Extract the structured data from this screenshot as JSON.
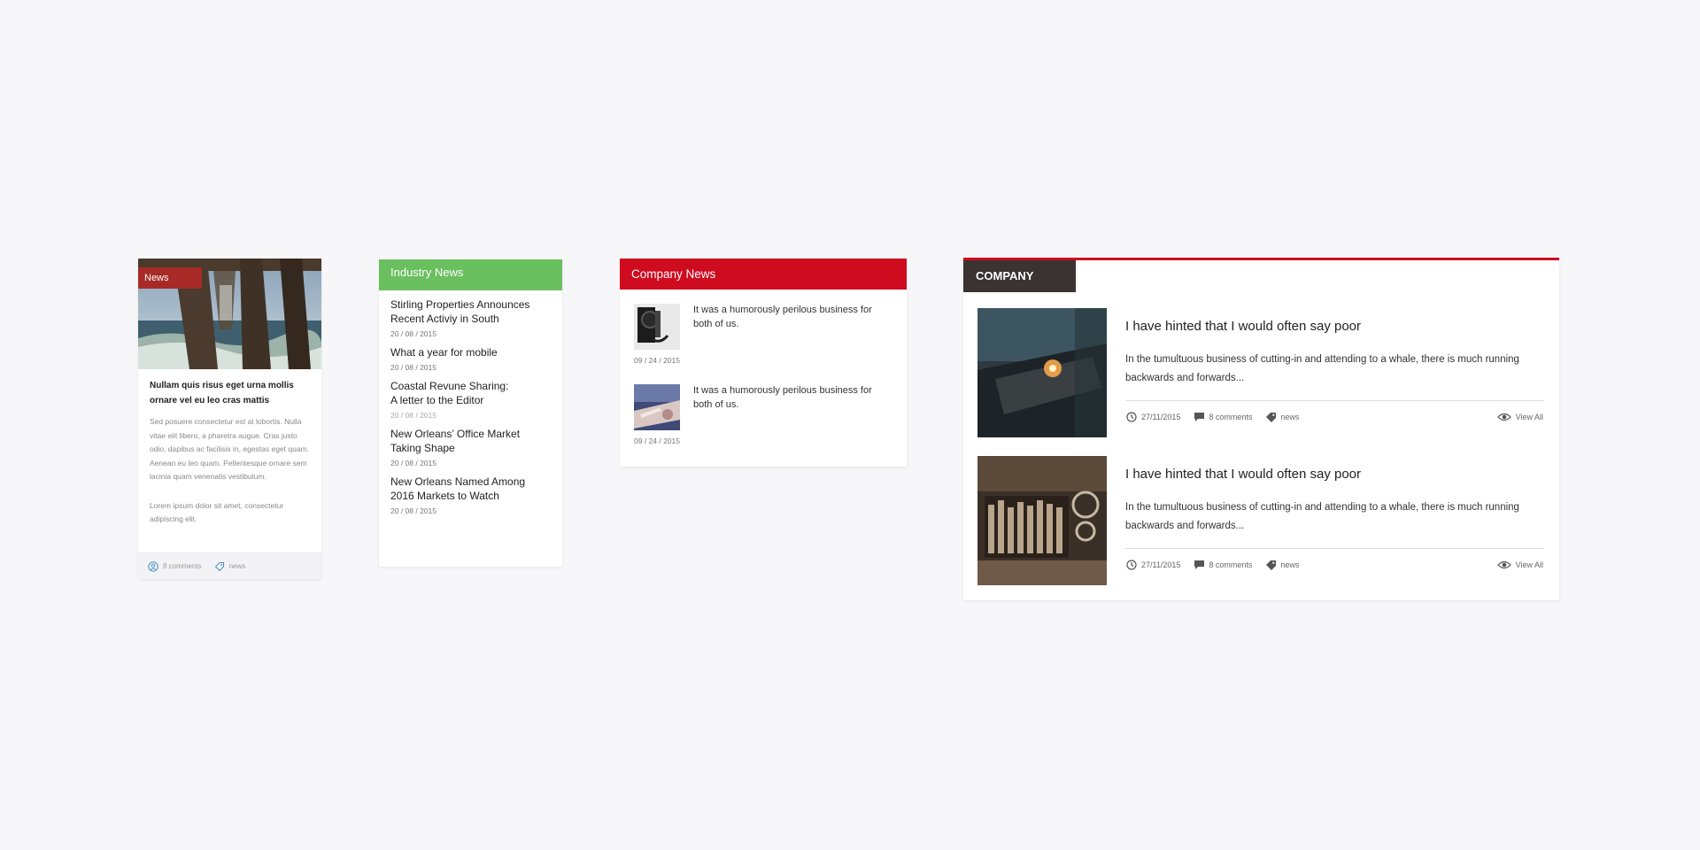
{
  "widget1": {
    "badge": "News",
    "title": "Nullam quis risus eget urna mollis ornare vel eu leo cras mattis",
    "body1": "Sed posuere consectetur est at lobortis. Nulla vitae elit libero, a pharetra augue. Cras justo odio, dapibus ac facilisis in, egestas eget quam. Aenean eu leo quam. Pellentesque ornare sem lacinia quam venenatis vestibulum.",
    "body2": "Lorem ipsum dolor sit amet, consectetur adipiscing elit.",
    "comments": "8 comments",
    "tag": "news"
  },
  "widget2": {
    "header": "Industry News",
    "items": [
      {
        "title": "Stirling Properties Announces Recent Activiy in South",
        "date": "20 / 08 / 2015"
      },
      {
        "title": "What a year for mobile",
        "date": "20 / 08 / 2015"
      },
      {
        "title": "Coastal Revune Sharing: A letter to the Editor",
        "date": "20 / 08 / 2015"
      },
      {
        "title": "New Orleans’ Office Market Taking Shape",
        "date": "20 / 08 / 2015"
      },
      {
        "title": "New Orleans Named Among 2016 Markets to Watch",
        "date": "20 / 08 / 2015"
      }
    ]
  },
  "widget3": {
    "header": "Company News",
    "items": [
      {
        "text": "It was a humorously perilous business for both of us.",
        "date": "09 / 24 / 2015"
      },
      {
        "text": "It was a humorously perilous business for both of us.",
        "date": "09 / 24 / 2015"
      }
    ]
  },
  "widget4": {
    "tag": "COMPANY",
    "accent": "#cf0b20",
    "items": [
      {
        "title": "I have hinted that I would often say poor",
        "excerpt": "In the tumultuous business of cutting-in and attending to a whale, there is much running backwards and forwards...",
        "date": "27/11/2015",
        "comments": "8 comments",
        "tag": "news",
        "view": "View All"
      },
      {
        "title": "I have hinted that I would often say poor",
        "excerpt": "In the tumultuous business of cutting-in and attending to a whale, there is much running backwards and forwards...",
        "date": "27/11/2015",
        "comments": "8 comments",
        "tag": "news",
        "view": "View All"
      }
    ]
  },
  "icons": [
    "user-icon",
    "tag-icon",
    "clock-icon",
    "comment-icon",
    "eye-icon"
  ]
}
